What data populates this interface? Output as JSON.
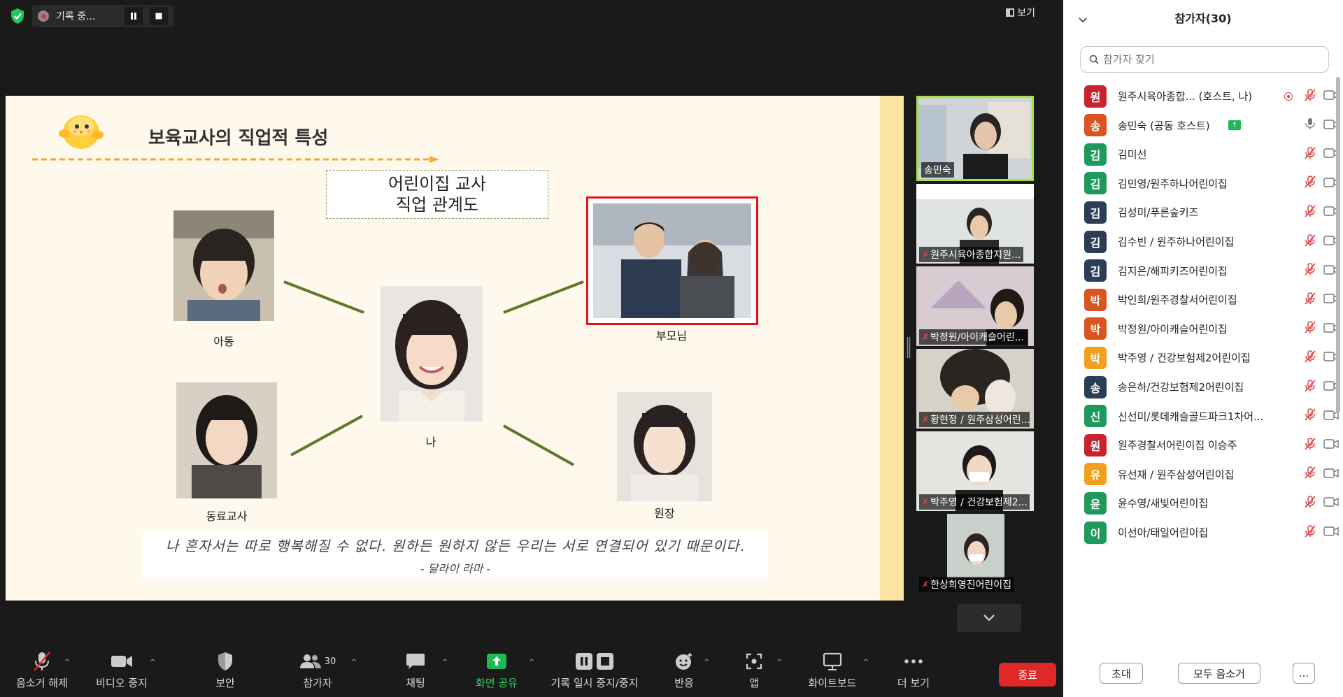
{
  "recording": {
    "label": "기록 중..."
  },
  "view": {
    "label": "보기"
  },
  "slide": {
    "title": "보육교사의 직업적 특성",
    "map_title_line1": "어린이집 교사",
    "map_title_line2": "직업 관계도",
    "captions": {
      "child": "아동",
      "me": "나",
      "parents": "부모님",
      "coworker": "동료교사",
      "director": "원장"
    },
    "quote": "나 혼자서는 따로 행복해질 수 없다. 원하든 원하지 않든 우리는 서로 연결되어 있기 때문이다.",
    "quote_author": "- 달라이 라마 -"
  },
  "video_tiles": [
    {
      "name": "송민숙",
      "muted": false,
      "active": true
    },
    {
      "name": "원주시육아종합지원...",
      "muted": true,
      "active": false
    },
    {
      "name": "박정원/아이캐슬어린...",
      "muted": true,
      "active": false
    },
    {
      "name": "황현정 / 원주삼성어린...",
      "muted": true,
      "active": false
    },
    {
      "name": "박주영 / 건강보험제2...",
      "muted": true,
      "active": false
    },
    {
      "name": "한상희영진어린이집",
      "muted": true,
      "active": false
    }
  ],
  "toolbar": {
    "unmute": "음소거 해제",
    "stop_video": "비디오 중지",
    "security": "보안",
    "participants": "참가자",
    "participants_count": "30",
    "chat": "채팅",
    "share_screen": "화면 공유",
    "pause_record": "기록 일시 중지/중지",
    "reactions": "반응",
    "apps": "앱",
    "whiteboard": "화이트보드",
    "more": "더 보기",
    "end": "종료"
  },
  "panel": {
    "title": "참가자(30)",
    "search_placeholder": "참가자 찾기",
    "invite": "초대",
    "mute_all": "모두 음소거",
    "more": "..."
  },
  "participants": [
    {
      "initial": "원",
      "name": "원주시육아종합... (호스트, 나)",
      "color": "#c8242f",
      "muted": true,
      "recording": true,
      "sharing": false
    },
    {
      "initial": "송",
      "name": "송민숙 (공동 호스트)",
      "color": "#d9541e",
      "muted": false,
      "recording": false,
      "sharing": true
    },
    {
      "initial": "김",
      "name": "김미선",
      "color": "#1f9a5d",
      "muted": true,
      "recording": false,
      "sharing": false
    },
    {
      "initial": "김",
      "name": "김민영/원주하나어린이집",
      "color": "#1f9a5d",
      "muted": true,
      "recording": false,
      "sharing": false
    },
    {
      "initial": "김",
      "name": "김성미/푸른숲키즈",
      "color": "#2c3e55",
      "muted": true,
      "recording": false,
      "sharing": false
    },
    {
      "initial": "김",
      "name": "김수빈 / 원주하나어린이집",
      "color": "#2c3e55",
      "muted": true,
      "recording": false,
      "sharing": false
    },
    {
      "initial": "김",
      "name": "김지은/해피키즈어린이집",
      "color": "#2c3e55",
      "muted": true,
      "recording": false,
      "sharing": false
    },
    {
      "initial": "박",
      "name": "박인희/원주경찰서어린이집",
      "color": "#d9541e",
      "muted": true,
      "recording": false,
      "sharing": false
    },
    {
      "initial": "박",
      "name": "박정원/아이캐슬어린이집",
      "color": "#d9541e",
      "muted": true,
      "recording": false,
      "sharing": false
    },
    {
      "initial": "박",
      "name": "박주영 / 건강보험제2어린이집",
      "color": "#f0a01c",
      "muted": true,
      "recording": false,
      "sharing": false
    },
    {
      "initial": "송",
      "name": "송은하/건강보험제2어린이집",
      "color": "#2c3e55",
      "muted": true,
      "recording": false,
      "sharing": false
    },
    {
      "initial": "신",
      "name": "신선미/롯데캐슬골드파크1차어...",
      "color": "#1f9a5d",
      "muted": true,
      "recording": false,
      "sharing": false
    },
    {
      "initial": "원",
      "name": "원주경찰서어린이집 이승주",
      "color": "#c8242f",
      "muted": true,
      "recording": false,
      "sharing": false
    },
    {
      "initial": "유",
      "name": "유선재 / 원주삼성어린이집",
      "color": "#f0a01c",
      "muted": true,
      "recording": false,
      "sharing": false
    },
    {
      "initial": "윤",
      "name": "윤수영/새빛어린이집",
      "color": "#1f9a5d",
      "muted": true,
      "recording": false,
      "sharing": false
    },
    {
      "initial": "이",
      "name": "이선아/태일어린이집",
      "color": "#1f9a5d",
      "muted": true,
      "recording": false,
      "sharing": false
    }
  ]
}
